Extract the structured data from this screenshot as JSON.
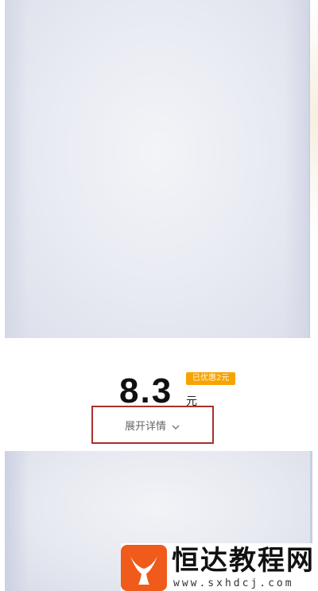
{
  "product": {
    "price_value": "8.3",
    "price_unit": "元",
    "discount_badge": "已优惠2元"
  },
  "details": {
    "expand_label": "展开详情"
  },
  "watermark": {
    "title": "恒达教程网",
    "url": "www.sxhdcj.com"
  },
  "icons": {
    "expand": "chevron-down-icon",
    "logo": "whale-tail-logo"
  },
  "colors": {
    "price": "#111111",
    "badge": "#f7a300",
    "highlight_border": "#a8312e",
    "logo": "#f05a1a"
  }
}
